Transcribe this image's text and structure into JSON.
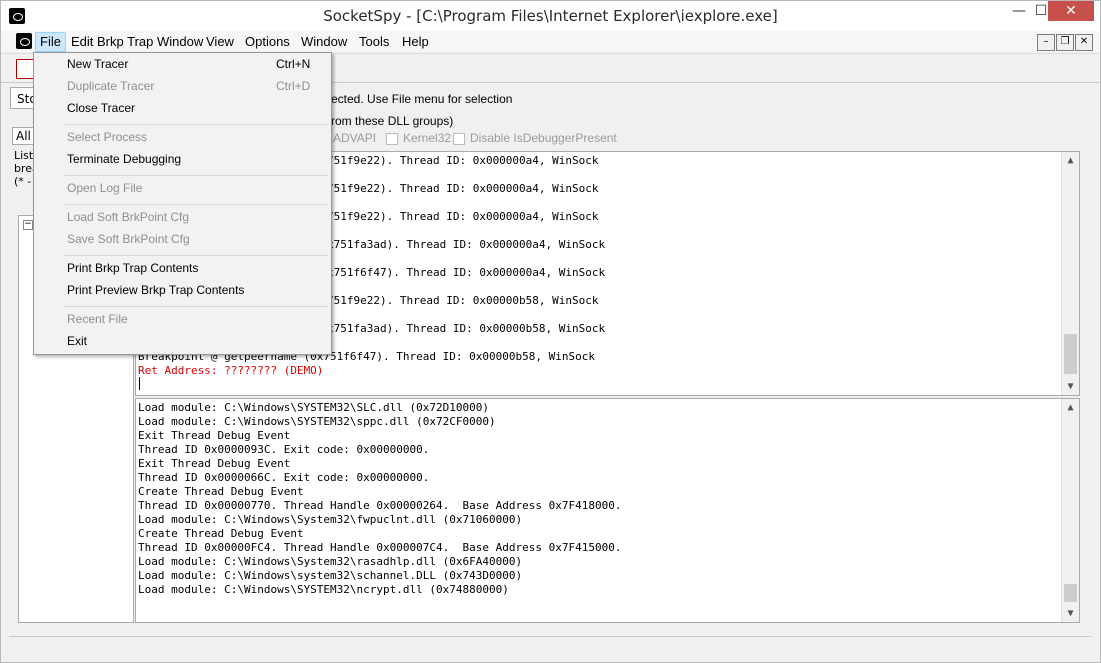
{
  "window": {
    "title": "SocketSpy - [C:\\Program Files\\Internet Explorer\\iexplore.exe]"
  },
  "caption": {
    "minimize": "—",
    "maximize": "☐",
    "close": "✕"
  },
  "menubar": {
    "items": [
      "File",
      "Edit Brkp Trap Window",
      "View",
      "Options",
      "Window",
      "Tools",
      "Help"
    ]
  },
  "mdi": {
    "minimize": "–",
    "restore": "❐",
    "close": "✕"
  },
  "file_menu": [
    {
      "label": "New Tracer",
      "shortcut": "Ctrl+N",
      "enabled": true
    },
    {
      "label": "Duplicate Tracer",
      "shortcut": "Ctrl+D",
      "enabled": false
    },
    {
      "label": "Close Tracer",
      "shortcut": "",
      "enabled": true
    },
    {
      "label": "Select Process",
      "shortcut": "",
      "enabled": false
    },
    {
      "label": "Terminate Debugging",
      "shortcut": "",
      "enabled": true
    },
    {
      "label": "Open Log File",
      "shortcut": "",
      "enabled": false
    },
    {
      "label": "Load Soft BrkPoint Cfg",
      "shortcut": "",
      "enabled": false
    },
    {
      "label": "Save Soft BrkPoint Cfg",
      "shortcut": "",
      "enabled": false
    },
    {
      "label": "Print Brkp Trap Contents",
      "shortcut": "",
      "enabled": true
    },
    {
      "label": "Print Preview Brkp Trap Contents",
      "shortcut": "",
      "enabled": true
    },
    {
      "label": "Recent File",
      "shortcut": "",
      "enabled": false
    },
    {
      "label": "Exit",
      "shortcut": "",
      "enabled": true
    }
  ],
  "left_panel": {
    "tab": "Sto",
    "field": "All",
    "text_lines": [
      "List",
      "brea",
      "(* -"
    ],
    "tree_toggle": "−"
  },
  "header": {
    "line1": "ected. Use File menu for selection",
    "line2": "rom these DLL groups)",
    "checkboxes": [
      "ADVAPI",
      "Kernel32",
      "Disable IsDebuggerPresent"
    ]
  },
  "trap_pane": {
    "lines": [
      {
        "text": "751f9e22). Thread ID: 0x000000a4, WinSock",
        "red": false
      },
      {
        "text": "751f9e22). Thread ID: 0x000000a4, WinSock",
        "red": false
      },
      {
        "text": "751f9e22). Thread ID: 0x000000a4, WinSock",
        "red": false
      },
      {
        "text": "x751fa3ad). Thread ID: 0x000000a4, WinSock",
        "red": false
      },
      {
        "text": "x751f6f47). Thread ID: 0x000000a4, WinSock",
        "red": false
      },
      {
        "text": "751f9e22). Thread ID: 0x00000b58, WinSock",
        "red": false
      },
      {
        "text": "x751fa3ad). Thread ID: 0x00000b58, WinSock",
        "red": false
      },
      {
        "text": "Breakpoint @ getpeername (0x751f6f47). Thread ID: 0x00000b58, WinSock",
        "red": false
      },
      {
        "text": "Ret Address: ???????? (DEMO)",
        "red": true
      }
    ]
  },
  "log_pane": {
    "lines": [
      "Load module: C:\\Windows\\SYSTEM32\\SLC.dll (0x72D10000)",
      "Load module: C:\\Windows\\SYSTEM32\\sppc.dll (0x72CF0000)",
      "Exit Thread Debug Event",
      "Thread ID 0x0000093C. Exit code: 0x00000000.",
      "Exit Thread Debug Event",
      "Thread ID 0x0000066C. Exit code: 0x00000000.",
      "Create Thread Debug Event",
      "Thread ID 0x00000770. Thread Handle 0x00000264.  Base Address 0x7F418000.",
      "Load module: C:\\Windows\\System32\\fwpuclnt.dll (0x71060000)",
      "Create Thread Debug Event",
      "Thread ID 0x00000FC4. Thread Handle 0x000007C4.  Base Address 0x7F415000.",
      "Load module: C:\\Windows\\System32\\rasadhlp.dll (0x6FA40000)",
      "Load module: C:\\Windows\\system32\\schannel.DLL (0x743D0000)",
      "Load module: C:\\Windows\\SYSTEM32\\ncrypt.dll (0x74880000)"
    ]
  },
  "scroll": {
    "up": "▲",
    "down": "▼"
  }
}
